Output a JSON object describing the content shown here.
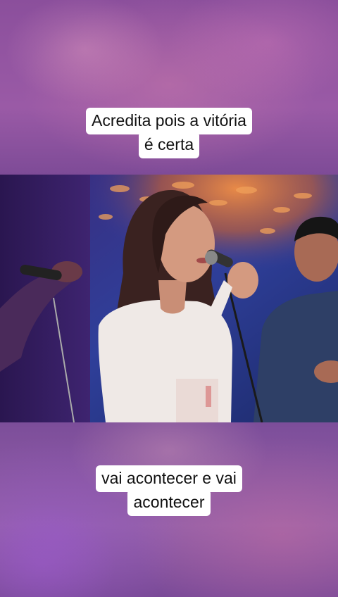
{
  "captions": {
    "top": {
      "line1": "Acredita pois a vitória",
      "line2": "é certa"
    },
    "bottom": {
      "line1": "vai acontecer e vai",
      "line2": "acontecer"
    }
  },
  "colors": {
    "caption_background": "#ffffff",
    "caption_text": "#111111",
    "backdrop": "#7c4a96"
  }
}
